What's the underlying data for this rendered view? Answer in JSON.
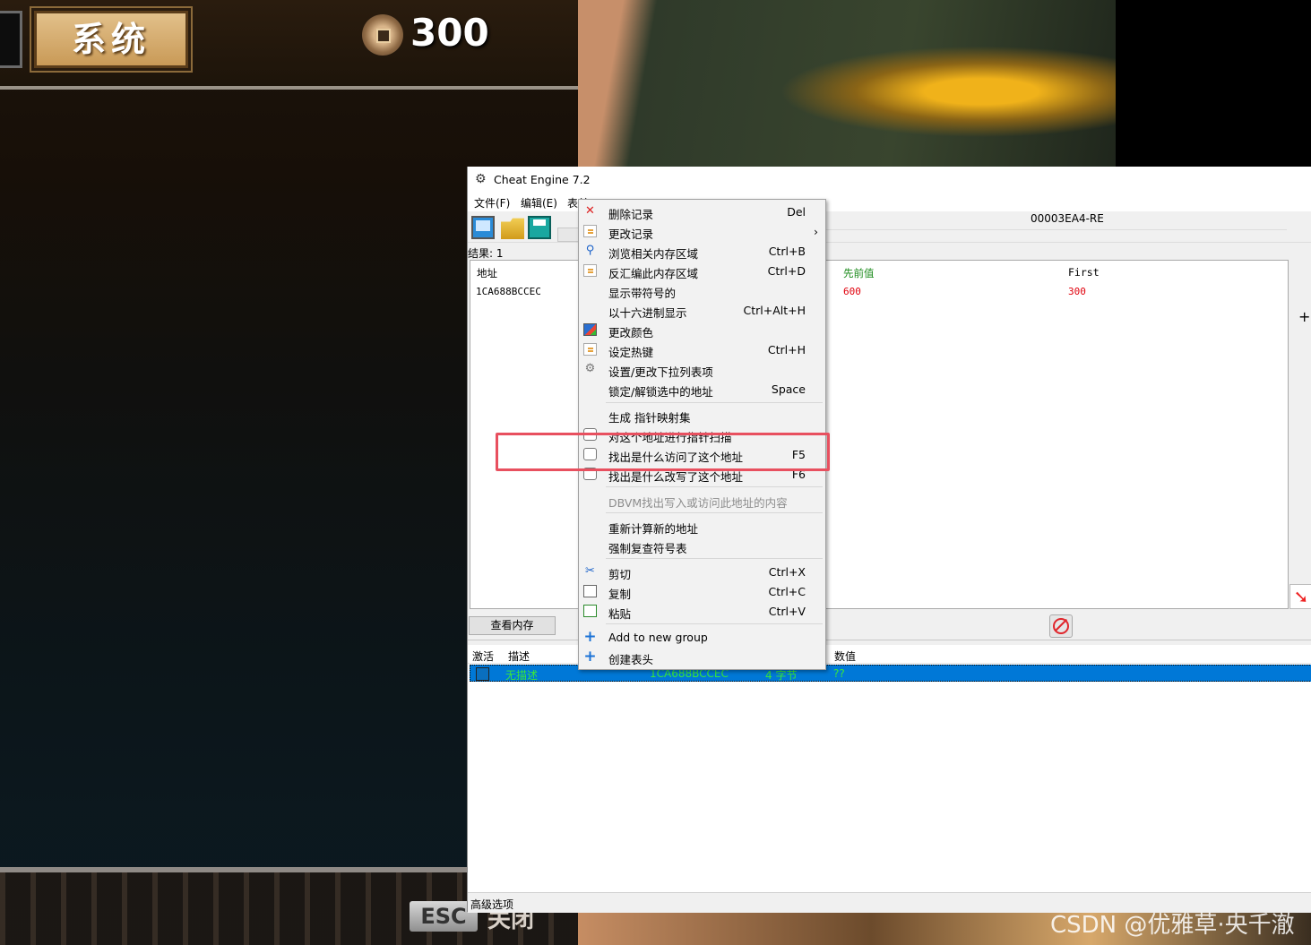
{
  "game": {
    "system_button": "系统",
    "coin_count": "300",
    "esc_key": "ESC",
    "esc_label": "关闭"
  },
  "watermark": "CSDN @优雅草·央千澈",
  "ce": {
    "title": "Cheat Engine 7.2",
    "menu": [
      "文件(F)",
      "编辑(E)",
      "表单"
    ],
    "process": "00003EA4-RE",
    "results_count": "结果: 1",
    "results": {
      "columns": {
        "address": "地址",
        "previous": "先前值",
        "first": "First"
      },
      "row": {
        "address": "1CA688BCCEC",
        "previous": "600",
        "first": "300"
      }
    },
    "view_memory_button": "查看内存",
    "plus_glyph": "+",
    "arrow_glyph": "➘",
    "table": {
      "columns": {
        "active": "激活",
        "description": "描述",
        "value": "数值"
      },
      "row": {
        "description": "无描述",
        "address": "1CA688BCCEC",
        "type": "4 字节",
        "value": "??"
      }
    },
    "advanced_options": "高级选项"
  },
  "context_menu": {
    "items": [
      {
        "label": "删除记录",
        "shortcut": "Del",
        "icon": "delete-icon"
      },
      {
        "label": "更改记录",
        "shortcut": "›",
        "icon": "edit-icon"
      },
      {
        "label": "浏览相关内存区域",
        "shortcut": "Ctrl+B",
        "icon": "binoculars-icon"
      },
      {
        "label": "反汇编此内存区域",
        "shortcut": "Ctrl+D",
        "icon": "disassemble-icon"
      },
      {
        "label": "显示带符号的",
        "shortcut": "",
        "icon": ""
      },
      {
        "label": "以十六进制显示",
        "shortcut": "Ctrl+Alt+H",
        "icon": ""
      },
      {
        "label": "更改颜色",
        "shortcut": "",
        "icon": "color-icon"
      },
      {
        "label": "设定热键",
        "shortcut": "Ctrl+H",
        "icon": "hotkey-icon"
      },
      {
        "label": "设置/更改下拉列表项",
        "shortcut": "",
        "icon": "gear-icon"
      },
      {
        "label": "锁定/解锁选中的地址",
        "shortcut": "Space",
        "icon": ""
      },
      {
        "label": "生成 指针映射集",
        "shortcut": "",
        "icon": ""
      },
      {
        "label": "对这个地址进行指针扫描",
        "shortcut": "",
        "icon": "pointer-scan-icon"
      },
      {
        "label": "找出是什么访问了这个地址",
        "shortcut": "F5",
        "icon": "find-access-icon"
      },
      {
        "label": "找出是什么改写了这个地址",
        "shortcut": "F6",
        "icon": "find-write-icon"
      },
      {
        "label": "DBVM找出写入或访问此地址的内容",
        "shortcut": "",
        "icon": ""
      },
      {
        "label": "重新计算新的地址",
        "shortcut": "",
        "icon": ""
      },
      {
        "label": "强制复查符号表",
        "shortcut": "",
        "icon": ""
      },
      {
        "label": "剪切",
        "shortcut": "Ctrl+X",
        "icon": "cut-icon"
      },
      {
        "label": "复制",
        "shortcut": "Ctrl+C",
        "icon": "copy-icon"
      },
      {
        "label": "粘贴",
        "shortcut": "Ctrl+V",
        "icon": "paste-icon"
      },
      {
        "label": "Add to new group",
        "shortcut": "",
        "icon": "plus-icon"
      },
      {
        "label": "创建表头",
        "shortcut": "",
        "icon": "plus-icon"
      }
    ],
    "delete_glyph": "✕",
    "binoculars_glyph": "⚲",
    "gear_glyph": "⚙",
    "scissors_glyph": "✂",
    "plus_glyph": "+",
    "highlight_color": "#e8505f"
  }
}
